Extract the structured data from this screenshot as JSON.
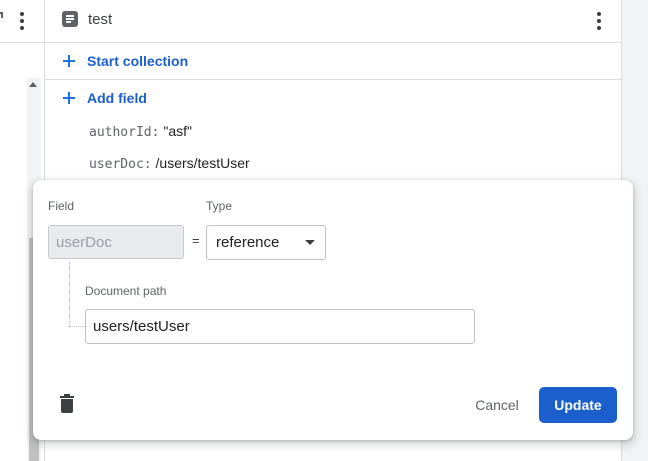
{
  "document": {
    "title": "test",
    "start_collection_label": "Start collection",
    "add_field_label": "Add field",
    "fields": [
      {
        "key": "authorId:",
        "value": "\"asf\""
      },
      {
        "key": "userDoc:",
        "value": "/users/testUser"
      }
    ]
  },
  "editor": {
    "field_label": "Field",
    "type_label": "Type",
    "field_value": "userDoc",
    "equals": "=",
    "type_value": "reference",
    "path_label": "Document path",
    "path_value": "users/testUser",
    "cancel_label": "Cancel",
    "update_label": "Update"
  },
  "icons": {
    "document": "document-icon",
    "more": "more-vert-icon",
    "add": "plus-icon",
    "dropdown": "chevron-down-icon",
    "delete": "trash-icon"
  },
  "colors": {
    "primary": "#1a5fcc",
    "link": "#1a73e8",
    "border": "#dadce0"
  }
}
